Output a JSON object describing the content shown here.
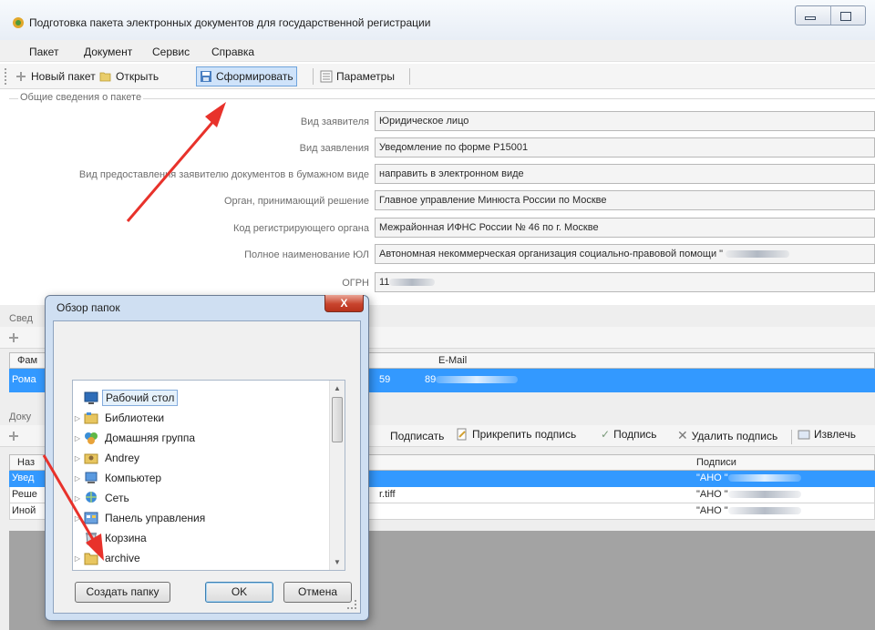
{
  "window": {
    "title": "Подготовка пакета электронных документов для государственной регистрации"
  },
  "menu": [
    "Пакет",
    "Документ",
    "Сервис",
    "Справка"
  ],
  "toolbar": {
    "new_package": "Новый пакет",
    "open": "Открыть",
    "form": "Сформировать",
    "params": "Параметры"
  },
  "general": {
    "title": "Общие сведения о пакете",
    "fields": [
      {
        "label": "Вид заявителя",
        "value": "Юридическое лицо"
      },
      {
        "label": "Вид заявления",
        "value": "Уведомление по форме Р15001"
      },
      {
        "label": "Вид предоставления заявителю документов в бумажном виде",
        "value": "направить в электронном виде"
      },
      {
        "label": "Орган, принимающий решение",
        "value": "Главное управление Минюста России по Москве"
      },
      {
        "label": "Код регистрирующего органа",
        "value": "Межрайонная ИФНС России № 46 по г. Москве"
      },
      {
        "label": "Полное наименование ЮЛ",
        "value": "Автономная некоммерческая организация социально-правовой помощи \""
      },
      {
        "label": "ОГРН",
        "value": "11"
      }
    ]
  },
  "applicants": {
    "section_label": "Свед",
    "col_surname": "Фам",
    "col_email": "E-Mail",
    "row": {
      "surname": "Рома",
      "phone_tail": "59",
      "email": "89"
    }
  },
  "documents": {
    "section_label": "Доку",
    "toolbar": {
      "sign": "Подписать",
      "attach_sign": "Прикрепить подпись",
      "signature": "Подпись",
      "delete_sign": "Удалить подпись",
      "extract": "Извлечь"
    },
    "col_name": "Наз",
    "col_signs": "Подписи",
    "rows": [
      {
        "name": "Увед",
        "file": "",
        "sign": "\"АНО \""
      },
      {
        "name": "Реше",
        "file": "r.tiff",
        "sign": "\"АНО \""
      },
      {
        "name": "Иной",
        "file": "",
        "sign": "\"АНО \""
      }
    ]
  },
  "dialog": {
    "title": "Обзор папок",
    "close": "X",
    "tree": [
      {
        "label": "Рабочий стол",
        "icon": "desktop-icon",
        "expander": ""
      },
      {
        "label": "Библиотеки",
        "icon": "libraries-icon",
        "expander": "▷"
      },
      {
        "label": "Домашняя группа",
        "icon": "homegroup-icon",
        "expander": "▷"
      },
      {
        "label": "Andrey",
        "icon": "user-folder-icon",
        "expander": "▷"
      },
      {
        "label": "Компьютер",
        "icon": "computer-icon",
        "expander": "▷"
      },
      {
        "label": "Сеть",
        "icon": "network-icon",
        "expander": "▷"
      },
      {
        "label": "Панель управления",
        "icon": "control-panel-icon",
        "expander": "▷"
      },
      {
        "label": "Корзина",
        "icon": "recycle-bin-icon",
        "expander": ""
      },
      {
        "label": "archive",
        "icon": "folder-icon",
        "expander": "▷"
      }
    ],
    "buttons": {
      "new_folder": "Создать папку",
      "ok": "OK",
      "cancel": "Отмена"
    }
  },
  "colors": {
    "accent": "#3399ff",
    "arrow": "#e8322b",
    "dialog_frame": "#cfdff2",
    "close_button": "#c8442d"
  }
}
